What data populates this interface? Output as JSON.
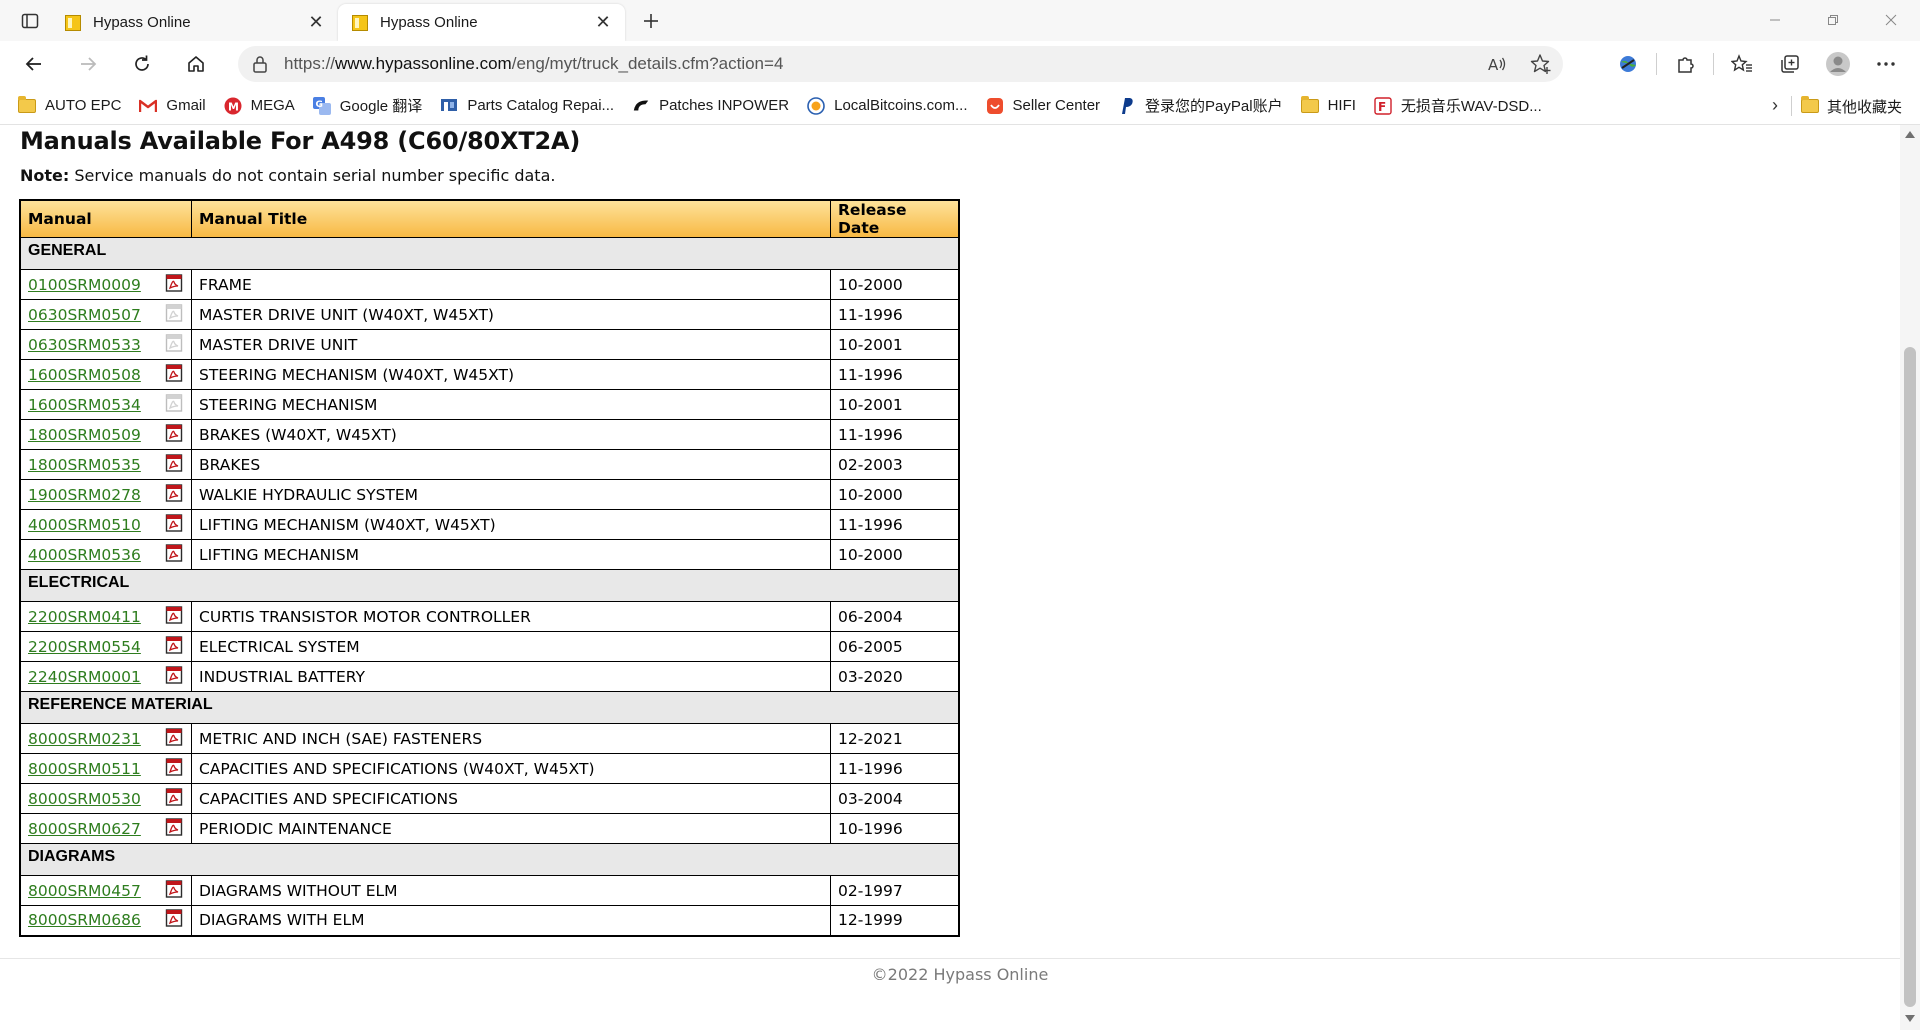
{
  "browser": {
    "tabs": [
      {
        "title": "Hypass Online",
        "active": false
      },
      {
        "title": "Hypass Online",
        "active": true
      }
    ],
    "url_prefix": "https://",
    "url_host": "www.hypassonline.com",
    "url_path": "/eng/myt/truck_details.cfm?action=4"
  },
  "bookmarks": [
    {
      "label": "AUTO EPC",
      "icon": "folder-icon"
    },
    {
      "label": "Gmail",
      "icon": "gmail-icon"
    },
    {
      "label": "MEGA",
      "icon": "mega-icon"
    },
    {
      "label": "Google 翻译",
      "icon": "google-translate-icon"
    },
    {
      "label": "Parts Catalog Repai...",
      "icon": "parts-catalog-icon"
    },
    {
      "label": "Patches INPOWER",
      "icon": "cummins-icon"
    },
    {
      "label": "LocalBitcoins.com...",
      "icon": "localbitcoins-icon"
    },
    {
      "label": "Seller Center",
      "icon": "seller-center-icon"
    },
    {
      "label": "登录您的PayPal账户",
      "icon": "paypal-icon"
    },
    {
      "label": "HIFI",
      "icon": "folder-icon"
    },
    {
      "label": "无损音乐WAV-DSD...",
      "icon": "music-icon"
    }
  ],
  "other_bookmarks": "其他收藏夹",
  "page": {
    "heading": "Manuals Available For A498 (C60/80XT2A)",
    "note_label": "Note:",
    "note_text": " Service manuals do not contain serial number specific data.",
    "table_headers": [
      "Manual",
      "Manual Title",
      "Release Date"
    ],
    "sections": [
      {
        "name": "GENERAL",
        "rows": [
          {
            "manual": "0100SRM0009",
            "title": "FRAME",
            "date": "10-2000",
            "pdf": true
          },
          {
            "manual": "0630SRM0507",
            "title": "MASTER DRIVE UNIT (W40XT, W45XT)",
            "date": "11-1996",
            "pdf": false
          },
          {
            "manual": "0630SRM0533",
            "title": "MASTER DRIVE UNIT",
            "date": "10-2001",
            "pdf": false
          },
          {
            "manual": "1600SRM0508",
            "title": "STEERING MECHANISM (W40XT, W45XT)",
            "date": "11-1996",
            "pdf": true
          },
          {
            "manual": "1600SRM0534",
            "title": "STEERING MECHANISM",
            "date": "10-2001",
            "pdf": false
          },
          {
            "manual": "1800SRM0509",
            "title": "BRAKES (W40XT, W45XT)",
            "date": "11-1996",
            "pdf": true
          },
          {
            "manual": "1800SRM0535",
            "title": "BRAKES",
            "date": "02-2003",
            "pdf": true
          },
          {
            "manual": "1900SRM0278",
            "title": "WALKIE HYDRAULIC SYSTEM",
            "date": "10-2000",
            "pdf": true
          },
          {
            "manual": "4000SRM0510",
            "title": "LIFTING MECHANISM (W40XT, W45XT)",
            "date": "11-1996",
            "pdf": true
          },
          {
            "manual": "4000SRM0536",
            "title": "LIFTING MECHANISM",
            "date": "10-2000",
            "pdf": true
          }
        ]
      },
      {
        "name": "ELECTRICAL",
        "rows": [
          {
            "manual": "2200SRM0411",
            "title": "CURTIS TRANSISTOR MOTOR CONTROLLER",
            "date": "06-2004",
            "pdf": true
          },
          {
            "manual": "2200SRM0554",
            "title": "ELECTRICAL SYSTEM",
            "date": "06-2005",
            "pdf": true
          },
          {
            "manual": "2240SRM0001",
            "title": "INDUSTRIAL BATTERY",
            "date": "03-2020",
            "pdf": true
          }
        ]
      },
      {
        "name": "REFERENCE MATERIAL",
        "rows": [
          {
            "manual": "8000SRM0231",
            "title": "METRIC AND INCH (SAE) FASTENERS",
            "date": "12-2021",
            "pdf": true
          },
          {
            "manual": "8000SRM0511",
            "title": "CAPACITIES AND SPECIFICATIONS (W40XT, W45XT)",
            "date": "11-1996",
            "pdf": true
          },
          {
            "manual": "8000SRM0530",
            "title": "CAPACITIES AND SPECIFICATIONS",
            "date": "03-2004",
            "pdf": true
          },
          {
            "manual": "8000SRM0627",
            "title": "PERIODIC MAINTENANCE",
            "date": "10-1996",
            "pdf": true
          }
        ]
      },
      {
        "name": "DIAGRAMS",
        "rows": [
          {
            "manual": "8000SRM0457",
            "title": "DIAGRAMS WITHOUT ELM",
            "date": "02-1997",
            "pdf": true
          },
          {
            "manual": "8000SRM0686",
            "title": "DIAGRAMS WITH ELM",
            "date": "12-1999",
            "pdf": true
          }
        ]
      }
    ],
    "footer": "©2022 Hypass Online"
  },
  "colors": {
    "link": "#2e7d1e",
    "header_gradient_top": "#fde29a",
    "header_gradient_bottom": "#f8b944",
    "section_bg": "#e8e8e8",
    "pdf_red": "#c0161b"
  }
}
